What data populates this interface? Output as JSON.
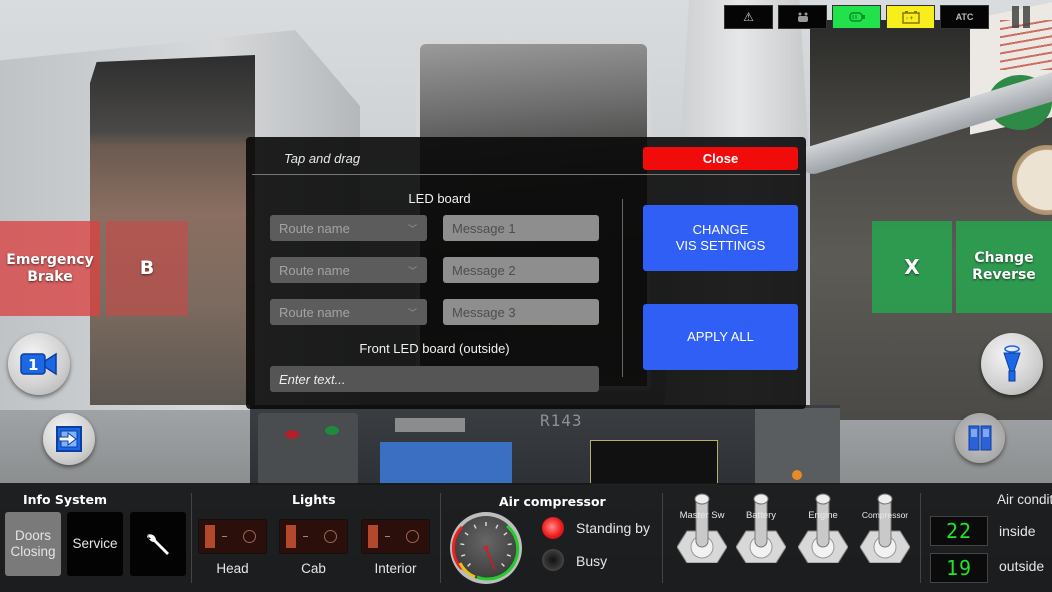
{
  "status_indicators": [
    {
      "name": "warning",
      "icon": "warning-triangle-icon",
      "glyph": "⚠",
      "color": "#050505"
    },
    {
      "name": "pantograph",
      "icon": "pantograph-icon",
      "glyph": "⏏",
      "color": "#050505"
    },
    {
      "name": "motor",
      "icon": "motor-icon",
      "glyph": "▭",
      "color": "#21e24a"
    },
    {
      "name": "battery",
      "icon": "battery-icon",
      "glyph": "▭",
      "color": "#f8ee1c"
    },
    {
      "name": "atc",
      "label": "ATC",
      "color": "#050505"
    }
  ],
  "pause_icon": "pause-icon",
  "left_controls": {
    "emergency_brake_label": "Emergency Brake",
    "b_label": "B",
    "camera_icon": "camera-1-icon",
    "camera_number": "1",
    "exit_icon": "exit-icon"
  },
  "right_controls": {
    "x_label": "X",
    "change_reverse_label": "Change Reverse",
    "horn_icon": "horn-icon",
    "doors_icon": "doors-icon"
  },
  "led_dialog": {
    "drag_hint": "Tap and drag",
    "close_label": "Close",
    "led_board_title": "LED board",
    "rows": [
      {
        "route_placeholder": "Route name",
        "message_placeholder": "Message 1"
      },
      {
        "route_placeholder": "Route name",
        "message_placeholder": "Message 2"
      },
      {
        "route_placeholder": "Route name",
        "message_placeholder": "Message 3"
      }
    ],
    "front_led_title": "Front LED board (outside)",
    "front_led_placeholder": "Enter text...",
    "change_vis_label": "CHANGE\nVIS SETTINGS",
    "apply_all_label": "APPLY ALL"
  },
  "scene": {
    "car_number": "R143"
  },
  "bottom_panel": {
    "info_system": {
      "title": "Info System",
      "buttons": [
        {
          "label": "Doors Closing",
          "active": true
        },
        {
          "label": "Service",
          "active": false
        },
        {
          "icon": "wrench-icon"
        }
      ]
    },
    "lights": {
      "title": "Lights",
      "switches": [
        {
          "label": "Head",
          "on": false
        },
        {
          "label": "Cab",
          "on": false
        },
        {
          "label": "Interior",
          "on": false
        }
      ]
    },
    "air_compressor": {
      "title": "Air compressor",
      "gauge_fraction": 0.42,
      "indicators": [
        {
          "label": "Standing by",
          "on": true
        },
        {
          "label": "Busy",
          "on": false
        }
      ]
    },
    "toggles": [
      {
        "label": "Master Sw"
      },
      {
        "label": "Battery"
      },
      {
        "label": "Engine"
      },
      {
        "label": "Compressor"
      }
    ],
    "air_conditioning": {
      "title": "Air conditioning",
      "inside_value": "22",
      "inside_label": "inside",
      "outside_value": "19",
      "outside_label": "outside"
    }
  }
}
